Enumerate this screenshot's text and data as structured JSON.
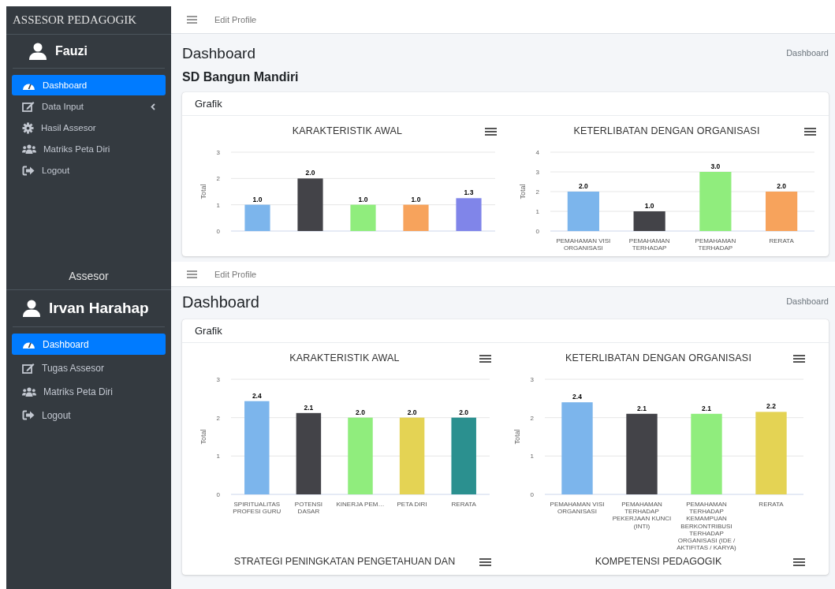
{
  "screens": [
    {
      "brand": "ASSESOR PEDAGOGIK",
      "user": "Fauzi",
      "header_link": "Edit Profile",
      "page_title": "Dashboard",
      "breadcrumb": "Dashboard",
      "subtitle": "SD Bangun Mandiri",
      "card_title": "Grafik",
      "nav": [
        {
          "label": "Dashboard",
          "kind": "gauge",
          "selected": true,
          "has_submenu": false
        },
        {
          "label": "Data Input",
          "kind": "edit",
          "selected": false,
          "has_submenu": true
        },
        {
          "label": "Hasil Assesor",
          "kind": "cog",
          "selected": false,
          "has_submenu": false
        },
        {
          "label": "Matriks Peta Diri",
          "kind": "users",
          "selected": false,
          "has_submenu": false
        },
        {
          "label": "Logout",
          "kind": "logout",
          "selected": false,
          "has_submenu": false
        }
      ],
      "charts": [
        {
          "bars": [
            {
              "color": "#7cb5ec"
            },
            {
              "color": "#434348"
            },
            {
              "color": "#90ed7d"
            },
            {
              "color": "#f7a35c"
            },
            {
              "color": "#8085e9"
            }
          ],
          "chart_data": {
            "type": "bar",
            "title": "KARAKTERISTIK AWAL",
            "ylabel": "Total",
            "values": [
              1.0,
              2.0,
              1.0,
              1.0,
              1.25
            ],
            "ylim": [
              0,
              3
            ],
            "yticks": [
              0,
              1,
              2,
              3
            ],
            "grid": true,
            "value_labels": [
              "1.0",
              "2.0",
              "1.0",
              "1.0",
              "1.3"
            ]
          }
        },
        {
          "bars": [
            {
              "color": "#7cb5ec"
            },
            {
              "color": "#434348"
            },
            {
              "color": "#90ed7d"
            },
            {
              "color": "#f7a35c"
            }
          ],
          "chart_data": {
            "type": "bar",
            "title": "KETERLIBATAN DENGAN ORGANISASI",
            "ylabel": "Total",
            "categories": [
              "PEMAHAMAN VISI ORGANISASI",
              "PEMAHAMAN TERHADAP",
              "PEMAHAMAN TERHADAP",
              "RERATA"
            ],
            "values": [
              2.0,
              1.0,
              3.0,
              2.0
            ],
            "ylim": [
              0,
              4
            ],
            "yticks": [
              0,
              1,
              2,
              3,
              4
            ],
            "grid": true,
            "value_labels": [
              "2.0",
              "1.0",
              "3.0",
              "2.0"
            ]
          }
        }
      ]
    },
    {
      "brand": "Assesor",
      "user": "Irvan Harahap",
      "header_link": "Edit Profile",
      "page_title": "Dashboard",
      "breadcrumb": "Dashboard",
      "card_title": "Grafik",
      "nav": [
        {
          "label": "Dashboard",
          "kind": "gauge",
          "selected": true,
          "has_submenu": false
        },
        {
          "label": "Tugas Assesor",
          "kind": "edit",
          "selected": false,
          "has_submenu": false
        },
        {
          "label": "Matriks Peta Diri",
          "kind": "users",
          "selected": false,
          "has_submenu": false
        },
        {
          "label": "Logout",
          "kind": "logout",
          "selected": false,
          "has_submenu": false
        }
      ],
      "charts": [
        {
          "bars": [
            {
              "color": "#7cb5ec"
            },
            {
              "color": "#434348"
            },
            {
              "color": "#90ed7d"
            },
            {
              "color": "#e4d354"
            },
            {
              "color": "#2b908f"
            }
          ],
          "chart_data": {
            "type": "bar",
            "title": "KARAKTERISTIK AWAL",
            "ylabel": "Total",
            "categories": [
              "SPIRITUALITAS PROFESI GURU",
              "POTENSI DASAR",
              "KINERJA PEM…",
              "PETA DIRI",
              "RERATA"
            ],
            "values": [
              2.43,
              2.12,
              2.0,
              2.0,
              2.0
            ],
            "ylim": [
              0,
              3
            ],
            "yticks": [
              0,
              1,
              2,
              3
            ],
            "grid": true,
            "value_labels": [
              "2.4",
              "2.1",
              "2.0",
              "2.0",
              "2.0"
            ]
          }
        },
        {
          "bars": [
            {
              "color": "#7cb5ec"
            },
            {
              "color": "#434348"
            },
            {
              "color": "#90ed7d"
            },
            {
              "color": "#e4d354"
            }
          ],
          "chart_data": {
            "type": "bar",
            "title": "KETERLIBATAN DENGAN ORGANISASI",
            "ylabel": "Total",
            "categories": [
              "PEMAHAMAN VISI ORGANISASI",
              "PEMAHAMAN TERHADAP PEKERJAAN KUNCI (INTI)",
              "PEMAHAMAN TERHADAP KEMAMPUAN BERKONTRIBUSI TERHADAP ORGANISASI (IDE / AKTIFITAS / KARYA)",
              "RERATA"
            ],
            "values": [
              2.4,
              2.1,
              2.1,
              2.15
            ],
            "ylim": [
              0,
              3
            ],
            "yticks": [
              0,
              1,
              2,
              3
            ],
            "grid": true,
            "value_labels": [
              "2.4",
              "2.1",
              "2.1",
              "2.2"
            ]
          }
        }
      ],
      "more_charts": [
        {
          "title": "STRATEGI PENINGKATAN PENGETAHUAN DAN"
        },
        {
          "title": "KOMPETENSI PEDAGOGIK"
        }
      ]
    }
  ]
}
